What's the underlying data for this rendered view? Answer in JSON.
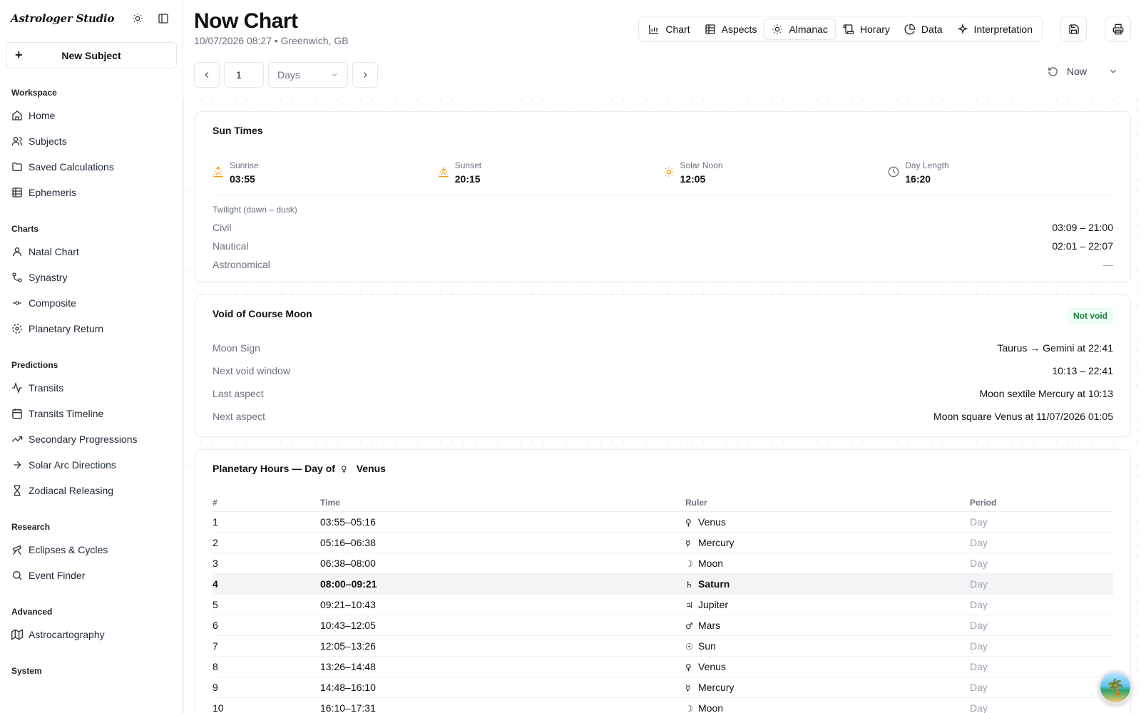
{
  "app": {
    "logo": "Astrologer Studio",
    "new_subject": "New Subject"
  },
  "sidebar": {
    "sections": [
      {
        "label": "Workspace",
        "items": [
          "Home",
          "Subjects",
          "Saved Calculations",
          "Ephemeris"
        ]
      },
      {
        "label": "Charts",
        "items": [
          "Natal Chart",
          "Synastry",
          "Composite",
          "Planetary Return"
        ]
      },
      {
        "label": "Predictions",
        "items": [
          "Transits",
          "Transits Timeline",
          "Secondary Progressions",
          "Solar Arc Directions",
          "Zodiacal Releasing"
        ]
      },
      {
        "label": "Research",
        "items": [
          "Eclipses & Cycles",
          "Event Finder"
        ]
      },
      {
        "label": "Advanced",
        "items": [
          "Astrocartography"
        ]
      },
      {
        "label": "System",
        "items": []
      }
    ]
  },
  "header": {
    "title": "Now Chart",
    "subtitle": "10/07/2026 08:27 • Greenwich, GB",
    "tabs": [
      "Chart",
      "Aspects",
      "Almanac",
      "Horary",
      "Data",
      "Interpretation"
    ],
    "active_tab": "Almanac"
  },
  "controls": {
    "step_value": "1",
    "unit": "Days",
    "now_label": "Now"
  },
  "sun_times": {
    "title": "Sun Times",
    "sunrise_label": "Sunrise",
    "sunrise": "03:55",
    "sunset_label": "Sunset",
    "sunset": "20:15",
    "noon_label": "Solar Noon",
    "noon": "12:05",
    "length_label": "Day Length",
    "length": "16:20",
    "twilight_label": "Twilight (dawn – dusk)",
    "civil_label": "Civil",
    "civil": "03:09 – 21:00",
    "nautical_label": "Nautical",
    "nautical": "02:01 – 22:07",
    "astro_label": "Astronomical",
    "astro": "—"
  },
  "void_moon": {
    "title": "Void of Course Moon",
    "badge": "Not void",
    "rows": [
      {
        "k": "Moon Sign",
        "v": "Taurus → Gemini at 22:41"
      },
      {
        "k": "Next void window",
        "v": "10:13 – 22:41"
      },
      {
        "k": "Last aspect",
        "v": "Moon sextile Mercury at 10:13"
      },
      {
        "k": "Next aspect",
        "v": "Moon square Venus at 11/07/2026 01:05"
      }
    ]
  },
  "planetary_hours": {
    "title_prefix": "Planetary Hours — Day of",
    "day_glyph": "♀",
    "day_ruler": "Venus",
    "columns": [
      "#",
      "Time",
      "Ruler",
      "Period"
    ],
    "current_index": 3,
    "rows": [
      {
        "n": "1",
        "time": "03:55–05:16",
        "glyph": "♀",
        "ruler": "Venus",
        "period": "Day"
      },
      {
        "n": "2",
        "time": "05:16–06:38",
        "glyph": "☿",
        "ruler": "Mercury",
        "period": "Day"
      },
      {
        "n": "3",
        "time": "06:38–08:00",
        "glyph": "☽",
        "ruler": "Moon",
        "period": "Day"
      },
      {
        "n": "4",
        "time": "08:00–09:21",
        "glyph": "♄",
        "ruler": "Saturn",
        "period": "Day"
      },
      {
        "n": "5",
        "time": "09:21–10:43",
        "glyph": "♃",
        "ruler": "Jupiter",
        "period": "Day"
      },
      {
        "n": "6",
        "time": "10:43–12:05",
        "glyph": "♂",
        "ruler": "Mars",
        "period": "Day"
      },
      {
        "n": "7",
        "time": "12:05–13:26",
        "glyph": "☉",
        "ruler": "Sun",
        "period": "Day"
      },
      {
        "n": "8",
        "time": "13:26–14:48",
        "glyph": "♀",
        "ruler": "Venus",
        "period": "Day"
      },
      {
        "n": "9",
        "time": "14:48–16:10",
        "glyph": "☿",
        "ruler": "Mercury",
        "period": "Day"
      },
      {
        "n": "10",
        "time": "16:10–17:31",
        "glyph": "☽",
        "ruler": "Moon",
        "period": "Day"
      }
    ]
  },
  "colors": {
    "accent_sun": "#f59e0b",
    "badge_green": "#15803d"
  },
  "icons": {
    "sidebar": [
      "home-icon",
      "users-icon",
      "folder-icon",
      "table-icon",
      "user-icon",
      "link-icon",
      "commit-icon",
      "orbit-icon",
      "activity-icon",
      "calendar-icon",
      "trending-up-icon",
      "arrow-right-icon",
      "hourglass-icon",
      "telescope-icon",
      "search-icon",
      "map-icon"
    ],
    "tabs": [
      "bar-chart-icon",
      "table-icon",
      "sun-icon",
      "scroll-icon",
      "pie-chart-icon",
      "sparkles-icon"
    ]
  }
}
